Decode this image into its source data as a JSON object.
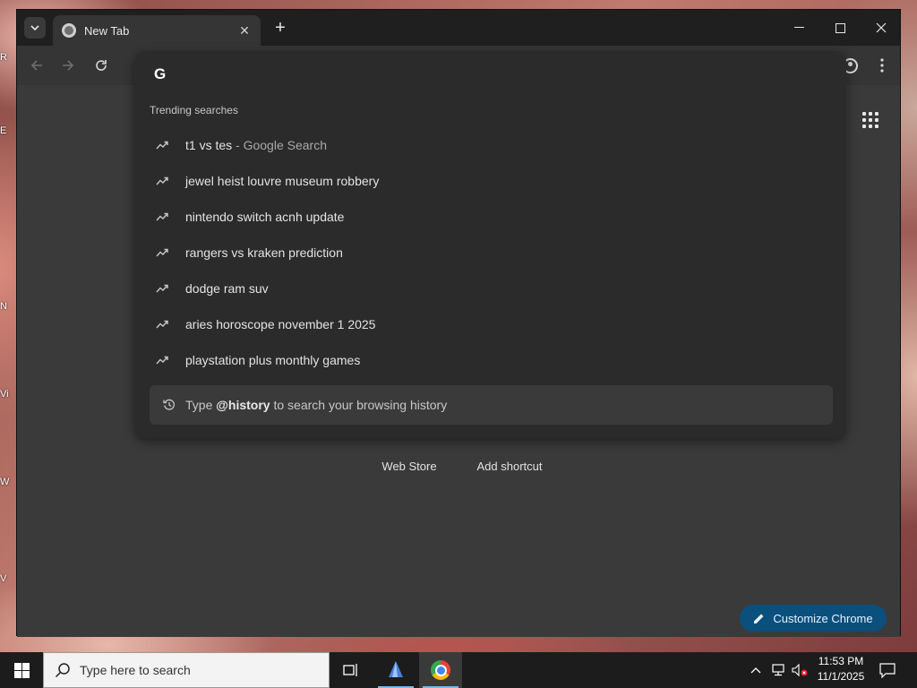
{
  "browser": {
    "tab": {
      "title": "New Tab"
    }
  },
  "omnibox": {
    "input_value": "",
    "trending_header": "Trending searches",
    "suggestions": [
      {
        "text": "t1 vs tes",
        "suffix": " - Google Search"
      },
      {
        "text": "jewel heist louvre museum robbery",
        "suffix": ""
      },
      {
        "text": "nintendo switch acnh update",
        "suffix": ""
      },
      {
        "text": "rangers vs kraken prediction",
        "suffix": ""
      },
      {
        "text": "dodge ram suv",
        "suffix": ""
      },
      {
        "text": "aries horoscope november 1 2025",
        "suffix": ""
      },
      {
        "text": "playstation plus monthly games",
        "suffix": ""
      }
    ],
    "history_hint": {
      "prefix": "Type ",
      "keyword": "@history",
      "suffix": " to search your browsing history"
    }
  },
  "page": {
    "shortcuts": [
      {
        "label": "Web Store"
      },
      {
        "label": "Add shortcut"
      }
    ],
    "customize_label": "Customize Chrome"
  },
  "taskbar": {
    "search_placeholder": "Type here to search",
    "time": "11:53 PM",
    "date": "11/1/2025"
  },
  "colors": {
    "accent": "#0b4f7c",
    "page_bg": "#3a3a3a",
    "dropdown_bg": "#2b2b2b"
  },
  "icons": [
    "tab-search-icon",
    "chrome-favicon-icon",
    "close-icon",
    "plus-icon",
    "minimize-icon",
    "maximize-icon",
    "back-icon",
    "forward-icon",
    "reload-icon",
    "google-g-icon",
    "trending-icon",
    "history-icon",
    "profile-icon",
    "kebab-menu-icon",
    "apps-grid-icon",
    "pencil-icon",
    "windows-logo-icon",
    "search-icon",
    "task-view-icon",
    "chrome-icon",
    "chevron-up-icon",
    "network-icon",
    "volume-muted-icon",
    "notifications-icon"
  ]
}
